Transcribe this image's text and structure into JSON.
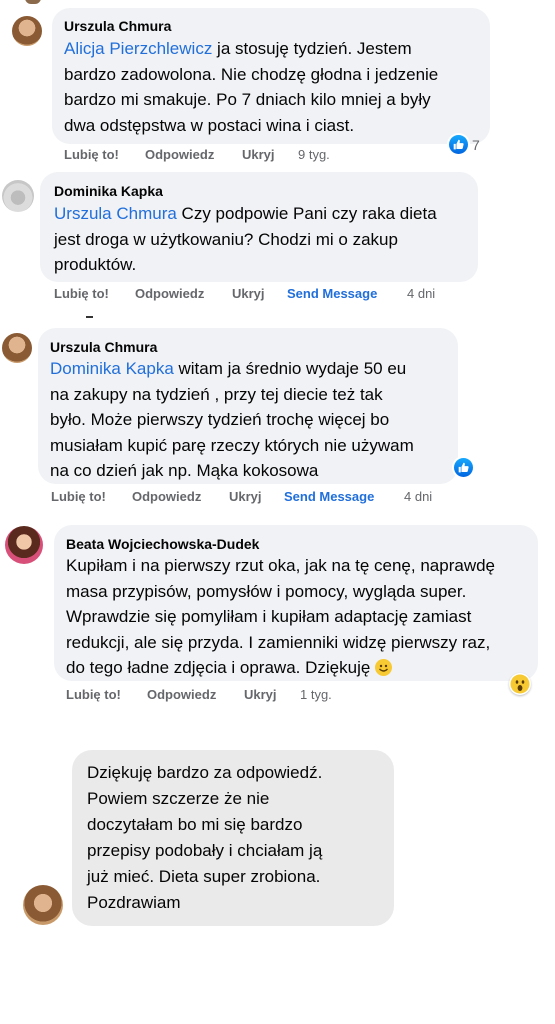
{
  "comments": [
    {
      "author": "Urszula Chmura",
      "mention": "Alicja Pierzchlewicz",
      "lines": [
        " ja stosuję tydzień. Jestem",
        "bardzo zadowolona. Nie chodzę głodna i jedzenie",
        "bardzo mi smakuje. Po 7 dniach kilo mniej a były",
        "dwa odstępstwa w postaci wina i ciast."
      ],
      "actions": {
        "like": "Lubię to!",
        "reply": "Odpowiedz",
        "hide": "Ukryj",
        "time": "9 tyg."
      },
      "reaction_count": "7"
    },
    {
      "author": "Dominika Kapka",
      "mention": "Urszula Chmura",
      "lines": [
        " Czy podpowie Pani czy raka dieta",
        "jest droga w użytkowaniu? Chodzi mi o zakup",
        "produktów."
      ],
      "actions": {
        "like": "Lubię to!",
        "reply": "Odpowiedz",
        "hide": "Ukryj",
        "send": "Send Message",
        "time": "4 dni"
      }
    },
    {
      "author": "Urszula Chmura",
      "mention": "Dominika Kapka",
      "lines": [
        " witam ja średnio wydaje 50 eu",
        "na zakupy na tydzień , przy tej diecie też tak",
        "było. Może pierwszy tydzień trochę więcej bo",
        "musiałam kupić parę rzeczy których nie używam",
        "na co dzień jak np. Mąka kokosowa"
      ],
      "actions": {
        "like": "Lubię to!",
        "reply": "Odpowiedz",
        "hide": "Ukryj",
        "send": "Send Message",
        "time": "4 dni"
      }
    },
    {
      "author": "Beata Wojciechowska-Dudek",
      "lines": [
        "Kupiłam i na pierwszy rzut oka, jak na tę cenę, naprawdę",
        "masa przypisów, pomysłów i pomocy, wygląda super.",
        "Wprawdzie się pomyliłam i kupiłam adaptację zamiast",
        "redukcji, ale się przyda. I zamienniki widzę pierwszy raz,",
        "do tego ładne zdjęcia i oprawa. Dziękuję"
      ],
      "actions": {
        "like": "Lubię to!",
        "reply": "Odpowiedz",
        "hide": "Ukryj",
        "time": "1 tyg."
      }
    }
  ],
  "message": {
    "lines": [
      "Dziękuję bardzo za odpowiedź.",
      "Powiem szczerze że nie",
      "doczytałam bo mi się bardzo",
      "przepisy podobały i chciałam ją",
      "już mieć. Dieta super zrobiona.",
      "Pozdrawiam"
    ]
  },
  "colors": {
    "bubble": "#f0f2f5",
    "link": "#216fdb",
    "meta": "#65676b",
    "like_blue": "#1877f2"
  }
}
